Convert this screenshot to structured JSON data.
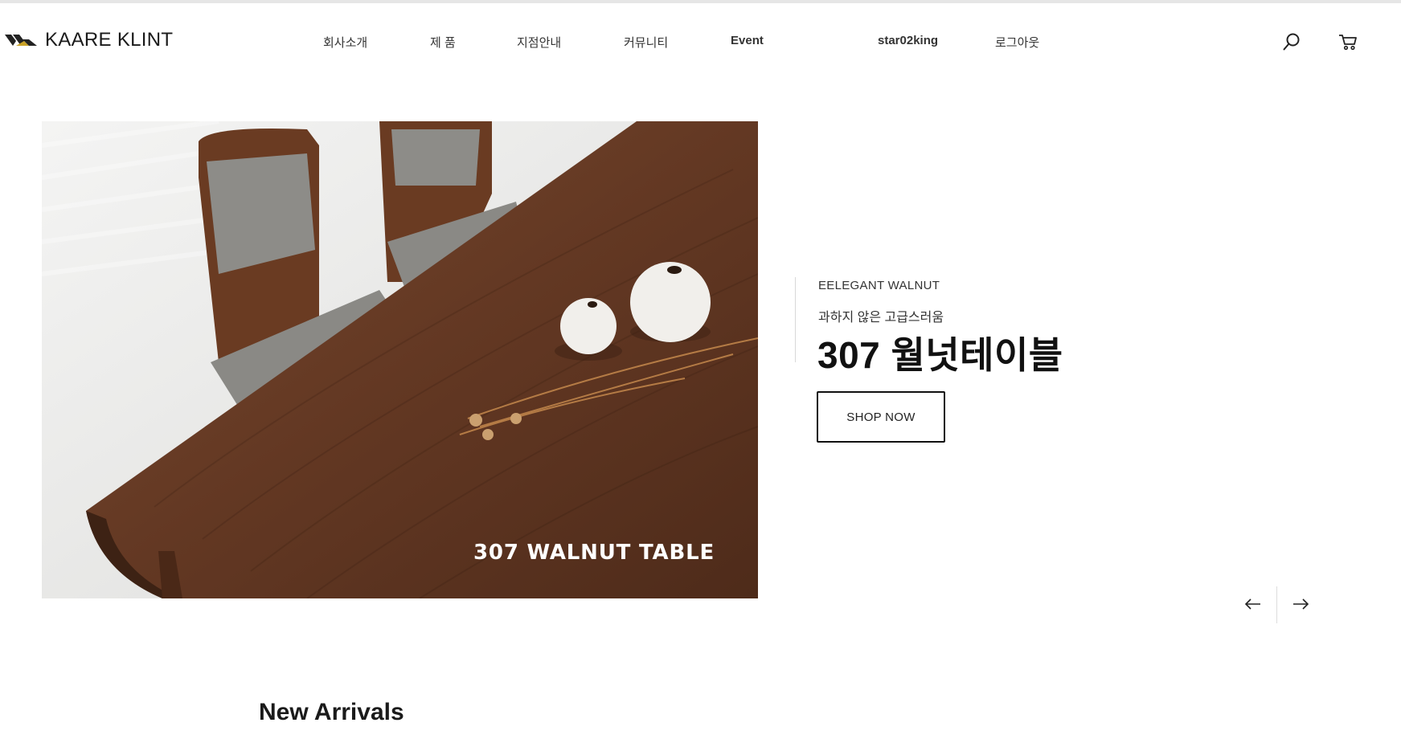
{
  "header": {
    "logo_text": "KAARE KLINT",
    "nav": [
      {
        "label": "회사소개"
      },
      {
        "label": "제 품"
      },
      {
        "label": "지점안내"
      },
      {
        "label": "커뮤니티"
      },
      {
        "label": "Event"
      },
      {
        "label": "star02king"
      },
      {
        "label": "로그아웃"
      }
    ],
    "icons": {
      "search": "search-icon",
      "cart": "cart-icon"
    }
  },
  "hero": {
    "image_caption": "307 WALNUT TABLE",
    "eyebrow": "EELEGANT WALNUT",
    "subtitle": "과하지 않은 고급스러움",
    "title": "307 월넛테이블",
    "cta_label": "SHOP NOW"
  },
  "slider": {
    "prev_icon": "arrow-left-icon",
    "next_icon": "arrow-right-icon"
  },
  "sections": {
    "new_arrivals_title": "New Arrivals"
  },
  "colors": {
    "text_dark": "#111111",
    "wood": "#6b3f26",
    "fabric": "#8c8c88",
    "vase": "#f1efeb"
  }
}
